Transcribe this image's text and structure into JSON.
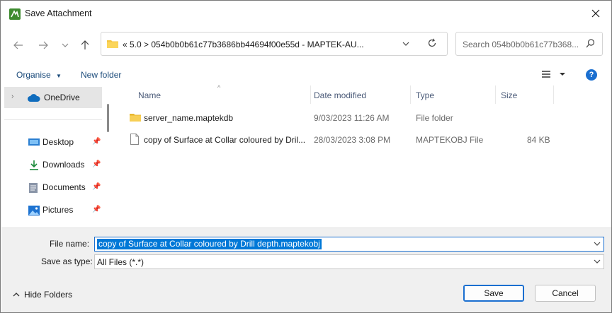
{
  "window": {
    "title": "Save Attachment"
  },
  "address": {
    "path": "«  5.0  >  054b0b0b61c77b3686bb44694f00e55d - MAPTEK-AU..."
  },
  "search": {
    "placeholder": "Search 054b0b0b61c77b368..."
  },
  "toolbar": {
    "organise": "Organise",
    "new_folder": "New folder"
  },
  "nav": {
    "onedrive": "OneDrive",
    "items": [
      {
        "label": "Desktop",
        "icon": "desktop-icon"
      },
      {
        "label": "Downloads",
        "icon": "download-icon"
      },
      {
        "label": "Documents",
        "icon": "documents-icon"
      },
      {
        "label": "Pictures",
        "icon": "pictures-icon"
      }
    ]
  },
  "columns": {
    "name": "Name",
    "date": "Date modified",
    "type": "Type",
    "size": "Size"
  },
  "files": [
    {
      "name": "server_name.maptekdb",
      "date": "9/03/2023 11:26 AM",
      "type": "File folder",
      "size": "",
      "icon": "folder-icon"
    },
    {
      "name": "copy of Surface at Collar coloured by Dril...",
      "date": "28/03/2023 3:08 PM",
      "type": "MAPTEKOBJ File",
      "size": "84 KB",
      "icon": "file-icon"
    }
  ],
  "form": {
    "file_name_label": "File name:",
    "file_name_value": "copy of Surface at Collar coloured by Drill depth.maptekobj",
    "save_as_type_label": "Save as type:",
    "save_as_type_value": "All Files (*.*)"
  },
  "buttons": {
    "hide_folders": "Hide Folders",
    "save": "Save",
    "cancel": "Cancel"
  },
  "colors": {
    "accent": "#0078d7",
    "app_icon": "#3d8b2f",
    "folder": "#f4c542"
  }
}
